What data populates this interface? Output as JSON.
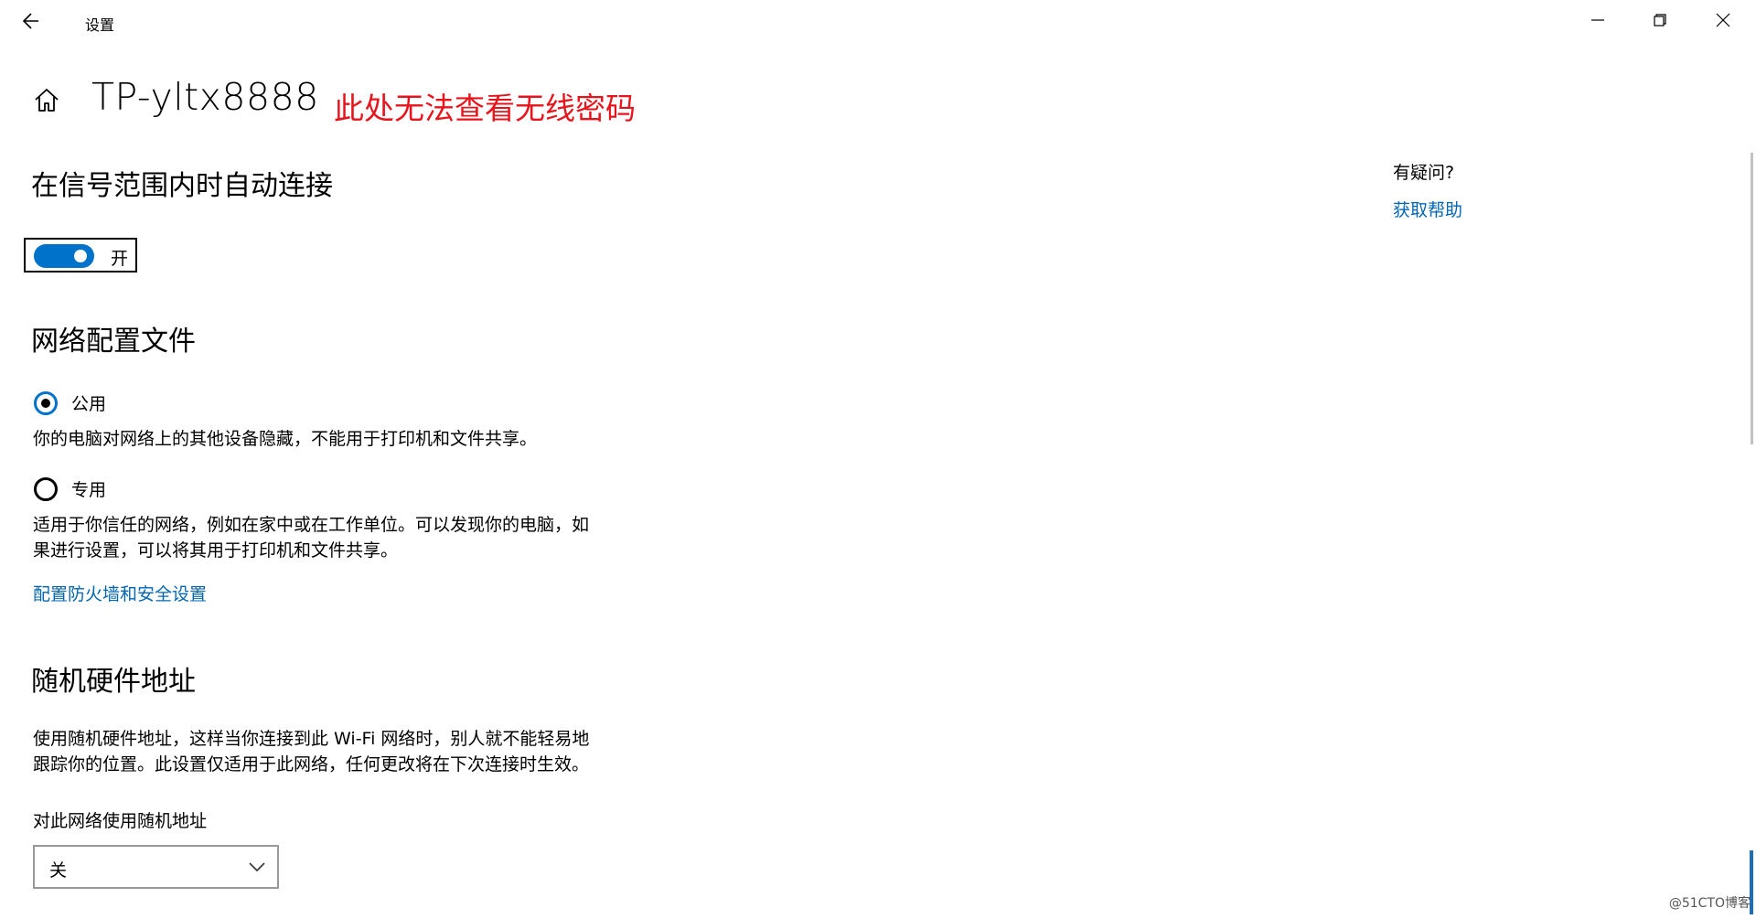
{
  "window": {
    "title": "设置",
    "controls": {
      "back_icon": "arrow-left-icon",
      "minimize_icon": "minimize-icon",
      "restore_icon": "restore-icon",
      "close_icon": "close-icon"
    }
  },
  "header": {
    "home_icon": "home-icon",
    "network_name": "TP-yltx8888",
    "annotation": "此处无法查看无线密码",
    "annotation_color": "#e8141c"
  },
  "auto_connect": {
    "heading": "在信号范围内时自动连接",
    "toggle_state_label": "开",
    "toggle_on": true,
    "accent_color": "#0072c9"
  },
  "network_profile": {
    "heading": "网络配置文件",
    "options": [
      {
        "label": "公用",
        "description": "你的电脑对网络上的其他设备隐藏，不能用于打印机和文件共享。",
        "selected": true
      },
      {
        "label": "专用",
        "description_line1": "适用于你信任的网络，例如在家中或在工作单位。可以发现你的电脑，如",
        "description_line2": "果进行设置，可以将其用于打印机和文件共享。",
        "selected": false
      }
    ],
    "firewall_link": "配置防火墙和安全设置",
    "link_color": "#0066b4"
  },
  "random_hardware": {
    "heading": "随机硬件地址",
    "description_line1": "使用随机硬件地址，这样当你连接到此 Wi-Fi 网络时，别人就不能轻易地",
    "description_line2": "跟踪你的位置。此设置仅适用于此网络，任何更改将在下次连接时生效。",
    "select_label": "对此网络使用随机地址",
    "select_value": "关",
    "select_icon": "chevron-down-icon"
  },
  "help": {
    "question": "有疑问?",
    "link": "获取帮助"
  },
  "watermark": "@51CTO博客"
}
